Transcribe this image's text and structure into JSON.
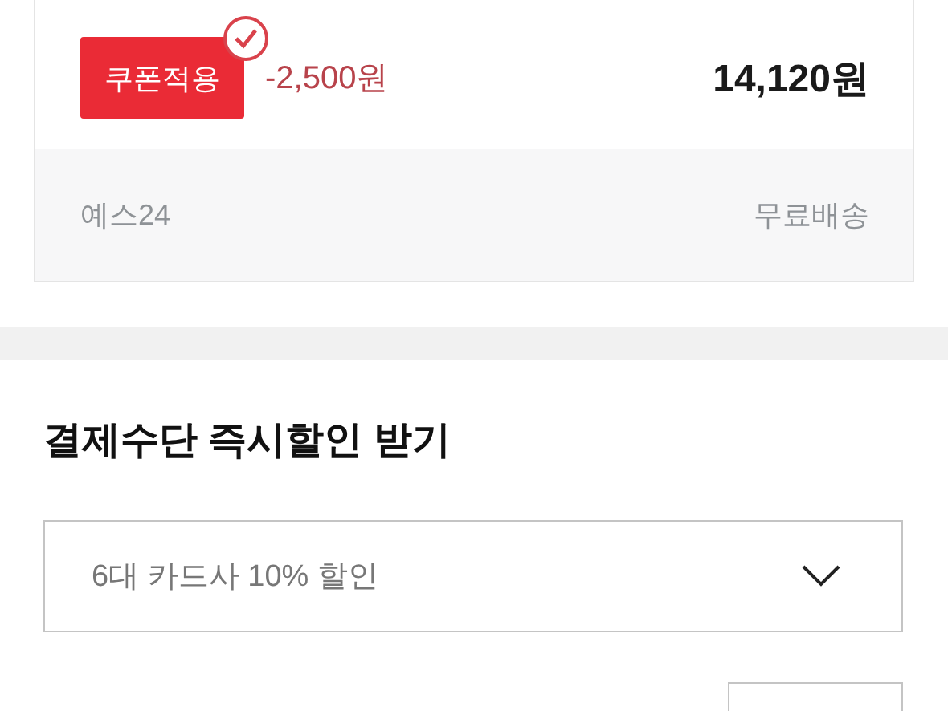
{
  "order_card": {
    "coupon_button": {
      "label": "쿠폰적용",
      "applied": true
    },
    "discount": "-2,500원",
    "price": "14,120원",
    "seller": "예스24",
    "shipping": "무료배송"
  },
  "payment_discount": {
    "title": "결제수단 즉시할인 받기",
    "dropdown": {
      "value": "6대 카드사 10% 할인",
      "expanded": false
    }
  }
}
